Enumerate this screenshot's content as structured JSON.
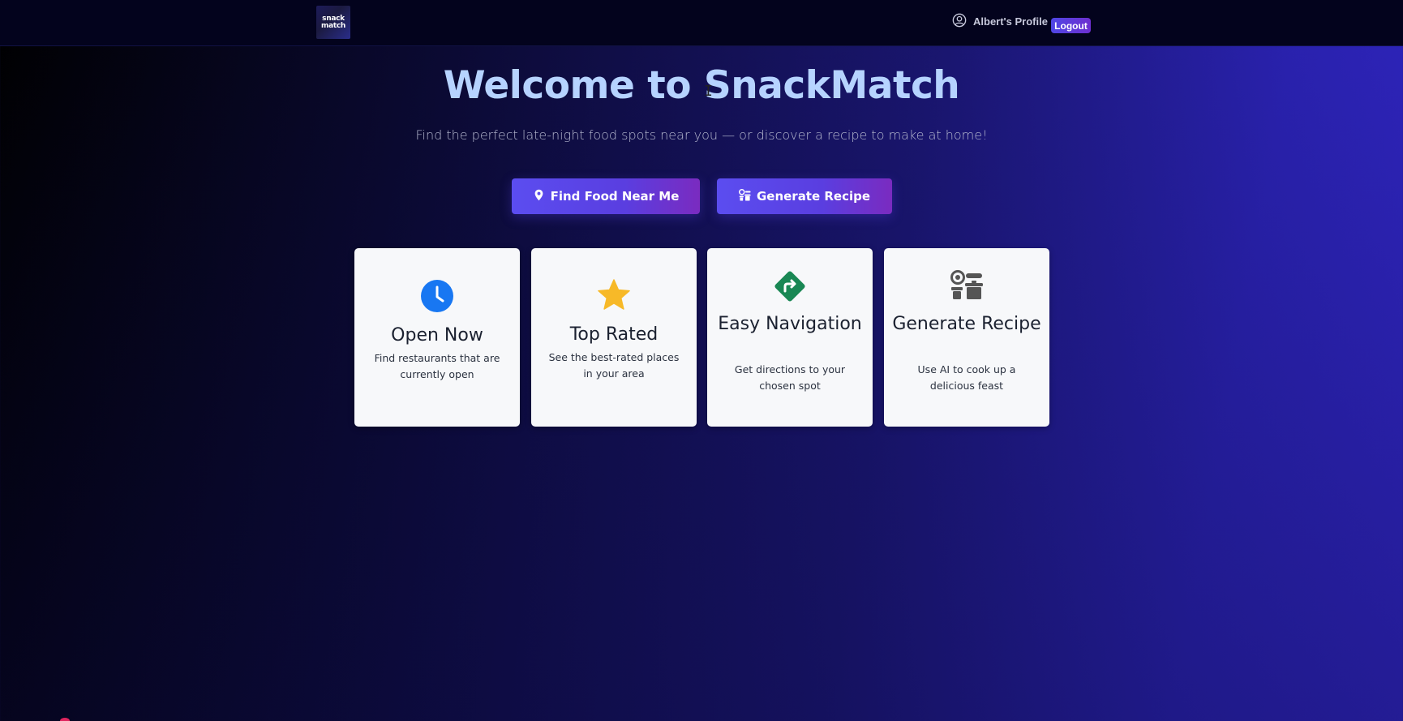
{
  "nav": {
    "logo_top": "snack",
    "logo_bottom": "match",
    "profile_label": "Albert's Profile",
    "profile_icon": "user-circle-icon",
    "logout_label": "Logout"
  },
  "hero": {
    "title": "Welcome to SnackMatch",
    "subtitle": "Find the perfect late-night food spots near you — or discover a recipe to make at home!",
    "find_button": {
      "label": "Find Food Near Me",
      "icon": "map-pin-icon"
    },
    "recipe_button": {
      "label": "Generate Recipe",
      "icon": "kitchen-icon"
    }
  },
  "features": [
    {
      "title": "Open Now",
      "desc": "Find restaurants that are currently open",
      "icon": "clock-icon",
      "color": "#1877f2"
    },
    {
      "title": "Top Rated",
      "desc": "See the best-rated places in your area",
      "icon": "star-icon",
      "color": "#f7b928"
    },
    {
      "title": "Easy Navigation",
      "desc": "Get directions to your chosen spot",
      "icon": "directions-icon",
      "color": "#198754"
    },
    {
      "title": "Generate Recipe",
      "desc": "Use AI to cook up a delicious feast",
      "icon": "kitchen-icon",
      "color": "#555555"
    }
  ],
  "colors": {
    "title": "#b6d3ff",
    "button_start": "#5b4df0",
    "button_end": "#7a2bc0",
    "navbar": "#03031d"
  }
}
